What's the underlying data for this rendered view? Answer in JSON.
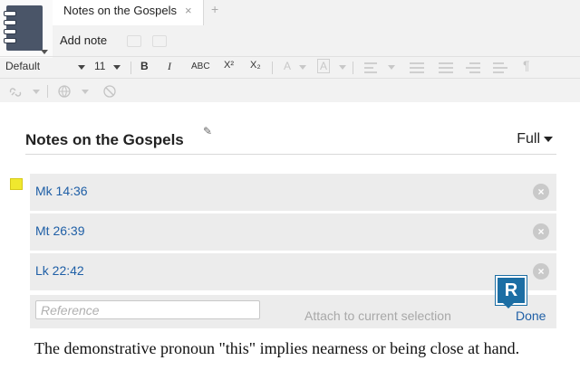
{
  "tab": {
    "title": "Notes on the Gospels",
    "close": "×",
    "new_tab": "+"
  },
  "toolbar": {
    "add_note_label": "Add note",
    "font_name": "Default",
    "font_size": "11",
    "bold": "B",
    "italic": "I",
    "small_caps": "ABC",
    "superscript": "X²",
    "subscript": "X₂",
    "font_color": "A",
    "highlight": "A",
    "paragraph": "¶"
  },
  "document": {
    "title": "Notes on the Gospels",
    "view_mode": "Full"
  },
  "references": [
    {
      "label": "Mk 14:36"
    },
    {
      "label": "Mt 26:39"
    },
    {
      "label": "Lk 22:42"
    }
  ],
  "reference_input": {
    "placeholder": "Reference",
    "value": "",
    "attach_label": "Attach to current selection",
    "done_label": "Done"
  },
  "logo_letter": "R",
  "note_text": "The demonstrative pronoun \"this\" implies nearness or being close at hand.",
  "colors": {
    "link": "#1f5fa6",
    "sticky_note": "#f0e82e",
    "notebook_icon": "#4a5568",
    "logo": "#1c6ea4"
  }
}
